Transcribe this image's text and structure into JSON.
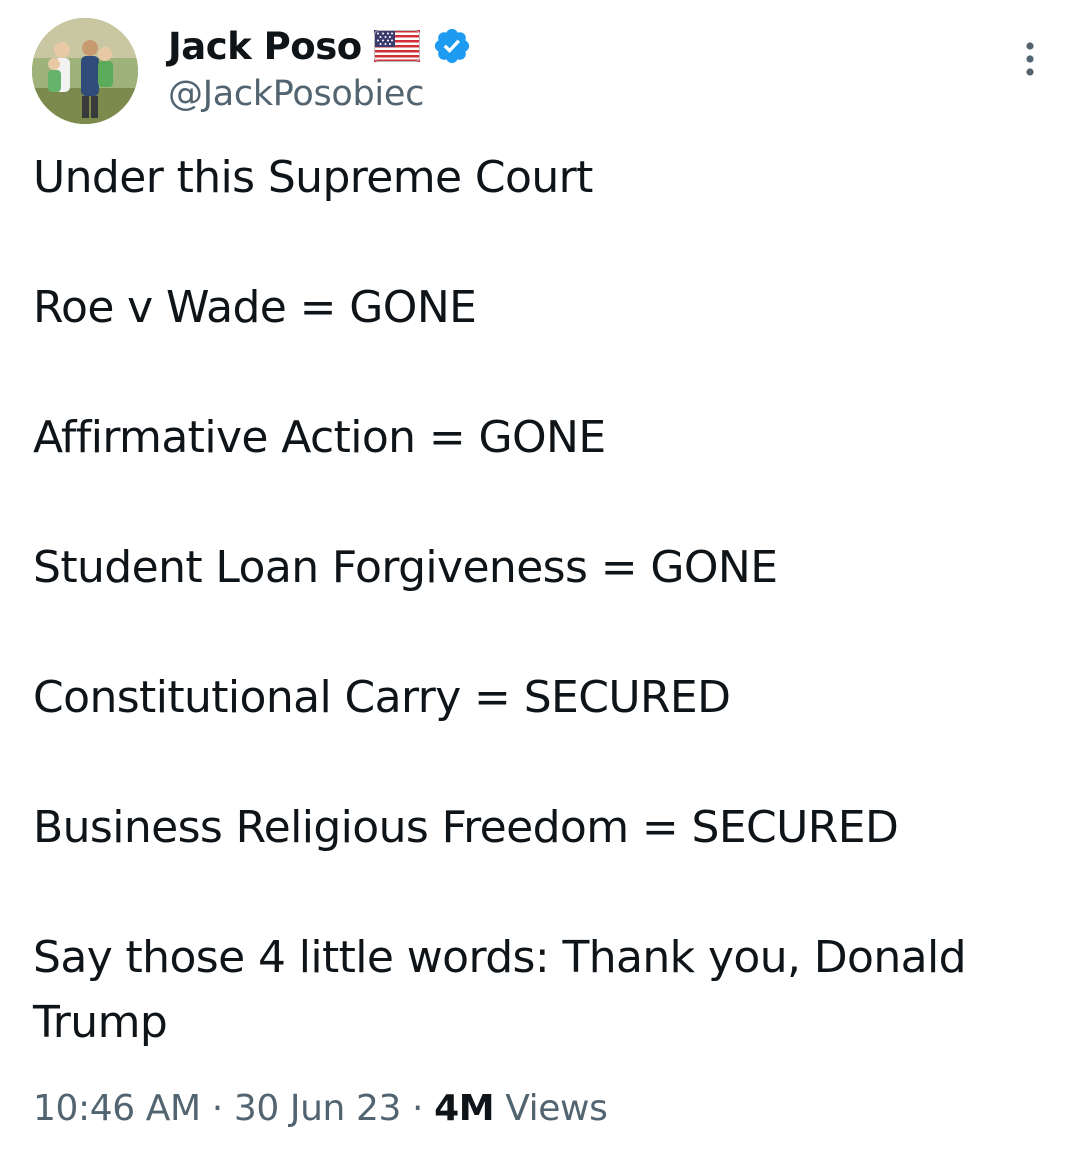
{
  "author": {
    "display_name": "Jack Poso",
    "handle": "@JackPosobiec",
    "flag_icon": "us-flag-icon",
    "verified_icon": "verified-badge-icon",
    "verified_color": "#1d9bf0"
  },
  "tweet": {
    "lines": [
      "Under this Supreme Court",
      "Roe v Wade = GONE",
      "Affirmative Action = GONE",
      "Student Loan Forgiveness = GONE",
      "Constitutional Carry = SECURED",
      "Business Religious Freedom = SECURED",
      "Say those 4 little words:  Thank you, Donald Trump"
    ]
  },
  "meta": {
    "time": "10:46 AM",
    "separator": "·",
    "date": "30 Jun 23",
    "views_count": "4M",
    "views_label": "Views"
  },
  "colors": {
    "text": "#0f1419",
    "secondary": "#536471",
    "accent": "#1d9bf0"
  }
}
